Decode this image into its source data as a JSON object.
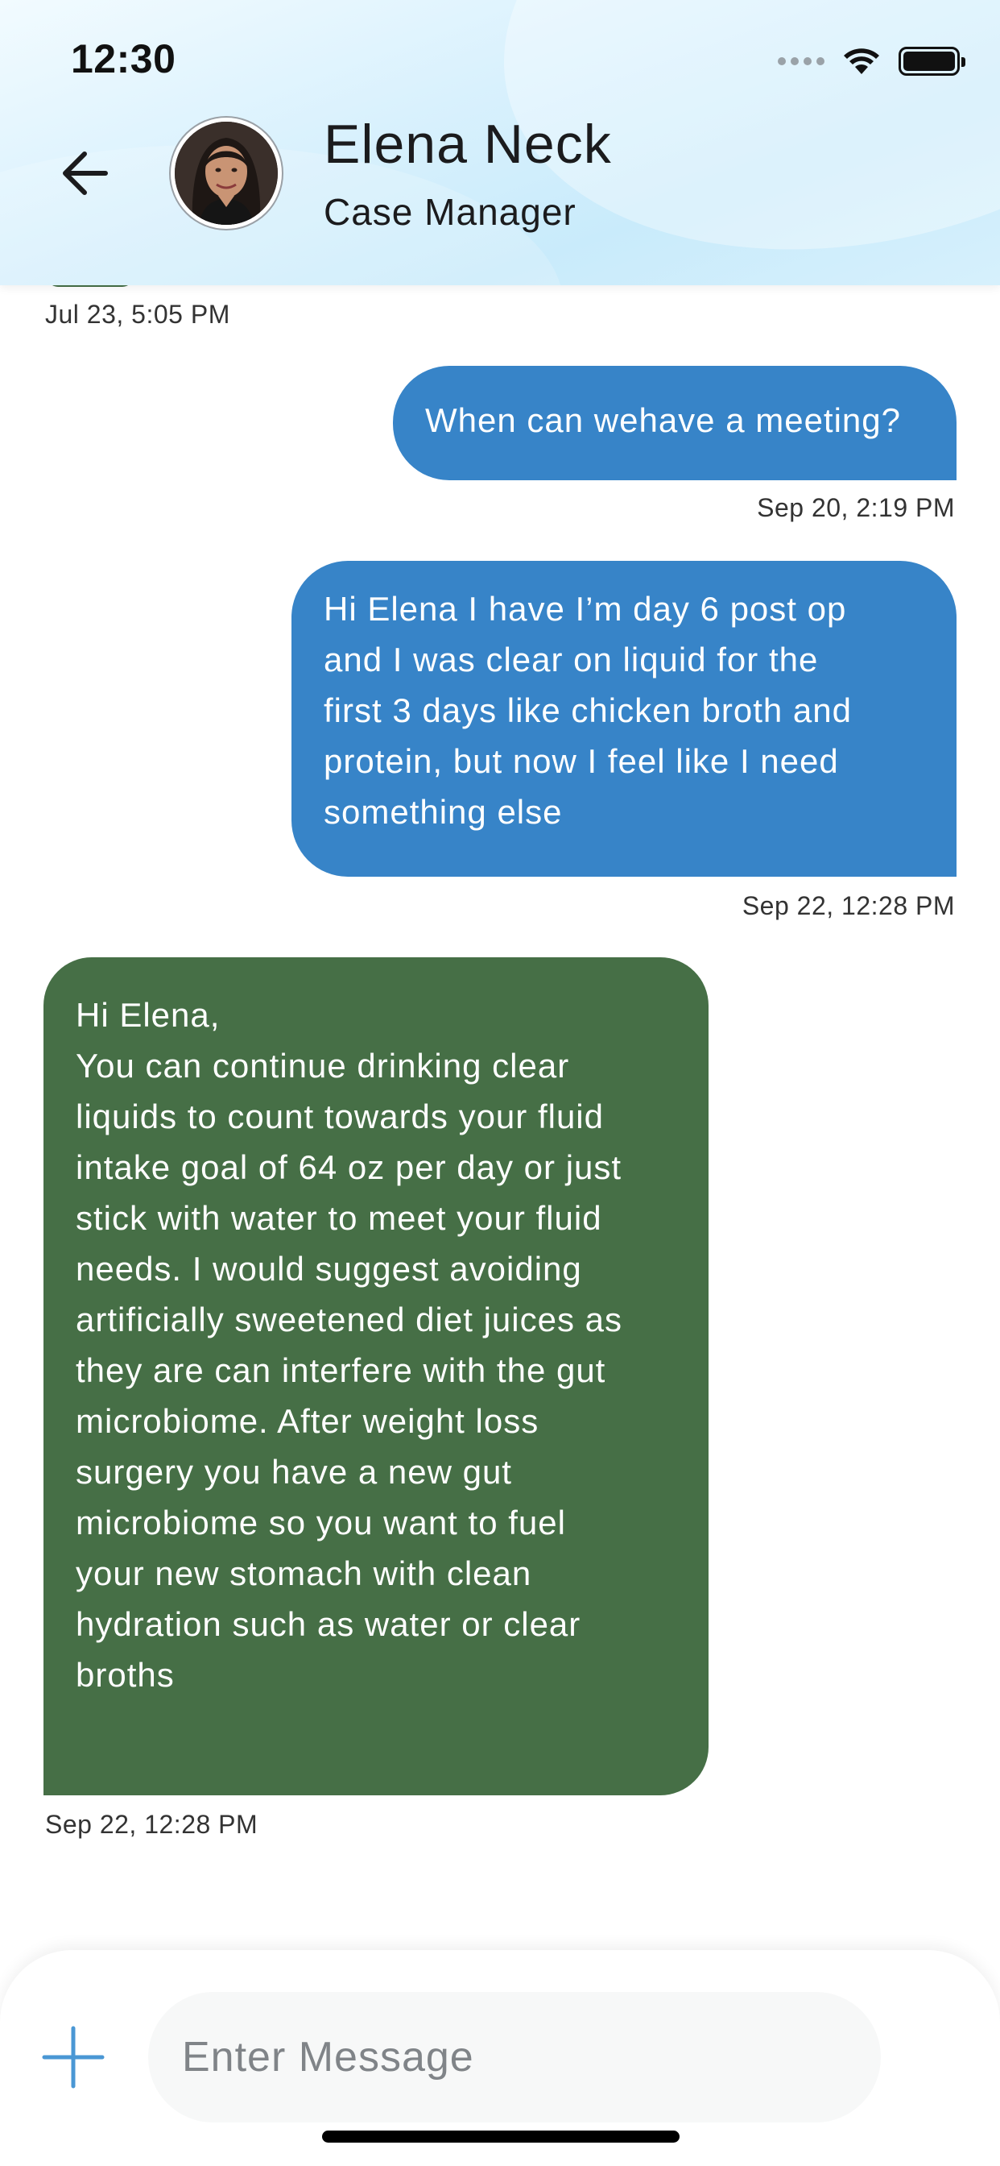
{
  "status_bar": {
    "time": "12:30"
  },
  "header": {
    "name": "Elena Neck",
    "role": "Case Manager",
    "back_icon": "arrow-left-icon",
    "avatar_icon": "profile-photo"
  },
  "messages": [
    {
      "type": "received",
      "timestamp": "Jul 23, 5:05 PM",
      "partial": true
    },
    {
      "type": "sent",
      "text": "When can wehave a meeting?",
      "timestamp": "Sep 20, 2:19 PM"
    },
    {
      "type": "sent",
      "lines": [
        "Hi Elena I have I’m day 6 post op",
        "and I was clear on liquid for the",
        "first 3 days like chicken broth and",
        "protein, but now I feel like I need",
        "something else"
      ],
      "timestamp": "Sep 22, 12:28 PM"
    },
    {
      "type": "received",
      "lines": [
        "Hi Elena,",
        "You can continue drinking clear",
        "liquids to count towards your fluid",
        "intake goal of 64 oz per day or just",
        "stick with water to meet your fluid",
        "needs. I would suggest avoiding",
        "artificially sweetened diet juices as",
        "they are can interfere with the gut",
        "microbiome. After weight loss",
        "surgery you have a new gut",
        "microbiome so you want to fuel",
        "your new stomach with clean",
        "hydration such as water or clear",
        "broths"
      ],
      "timestamp": "Sep 22, 12:28 PM"
    }
  ],
  "composer": {
    "placeholder": "Enter Message",
    "add_icon": "plus-icon"
  },
  "colors": {
    "sent_bubble": "#3784c8",
    "received_bubble": "#466f46",
    "accent": "#4a97d4"
  }
}
